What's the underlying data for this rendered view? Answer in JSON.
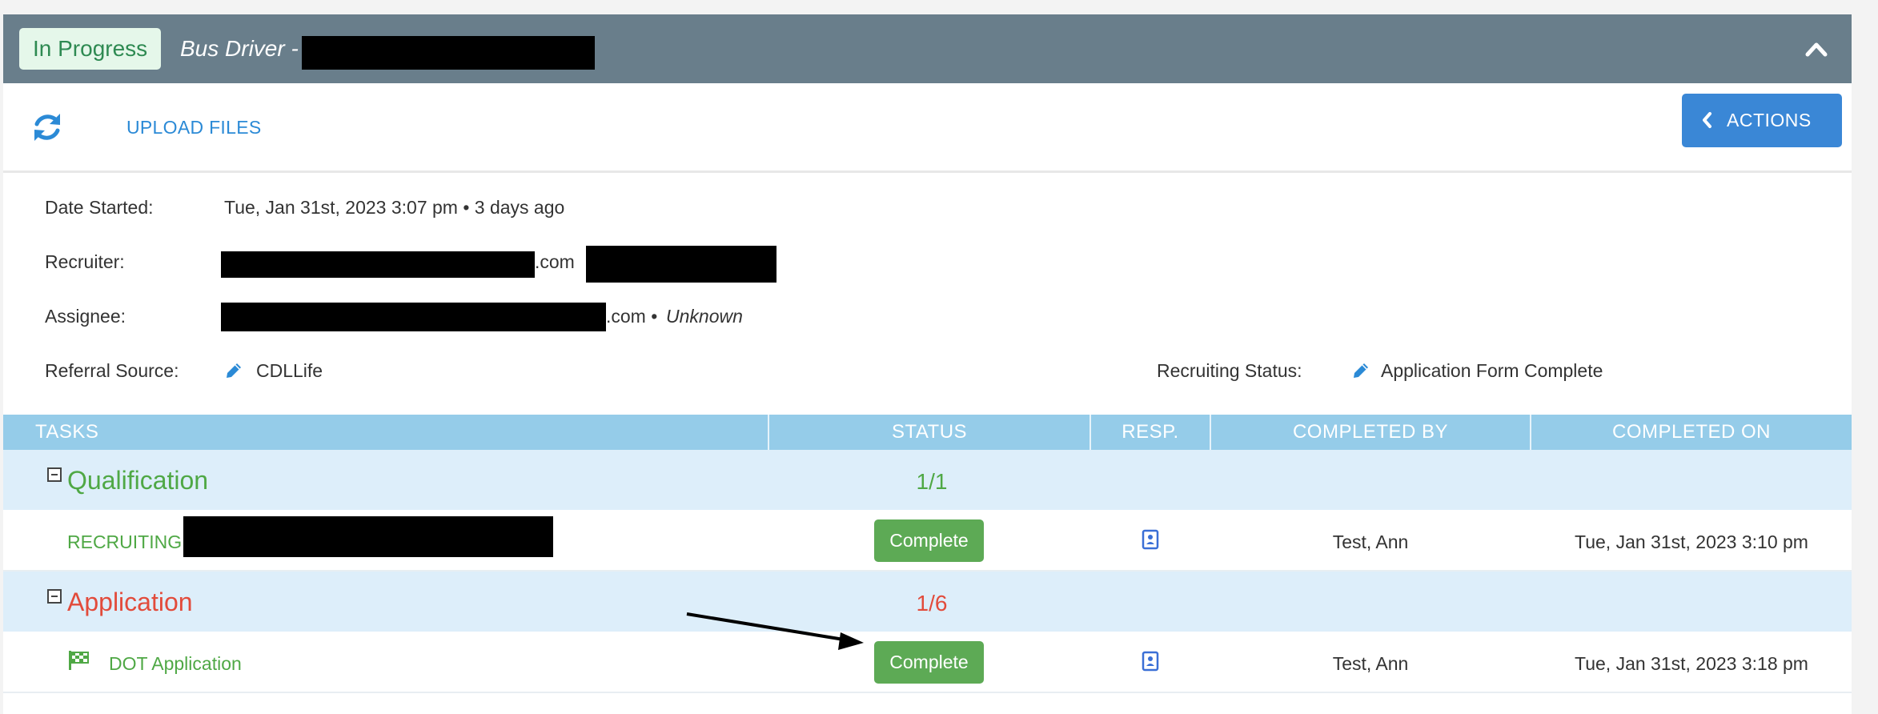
{
  "header": {
    "status_badge": "In Progress",
    "title": "Bus Driver -"
  },
  "toolbar": {
    "refresh_icon": "refresh-icon",
    "upload_label": "UPLOAD FILES",
    "actions_label": "ACTIONS"
  },
  "info": {
    "date_started_label": "Date Started:",
    "date_started_value": "Tue, Jan 31st, 2023 3:07 pm • 3 days ago",
    "recruiter_label": "Recruiter:",
    "recruiter_suffix": ".com",
    "assignee_label": "Assignee:",
    "assignee_suffix": ".com •",
    "assignee_status": "Unknown",
    "referral_label": "Referral Source:",
    "referral_value": "CDLLife",
    "recruiting_status_label": "Recruiting Status:",
    "recruiting_status_value": "Application Form Complete"
  },
  "table": {
    "headers": {
      "tasks": "TASKS",
      "status": "STATUS",
      "resp": "RESP.",
      "completed_by": "COMPLETED BY",
      "completed_on": "COMPLETED ON"
    },
    "groups": [
      {
        "name": "Qualification",
        "count": "1/1",
        "color": "#4fa845",
        "tasks": [
          {
            "name": "RECRUITING",
            "status": "Complete",
            "completed_by": "Test, Ann",
            "completed_on": "Tue, Jan 31st, 2023 3:10 pm"
          }
        ]
      },
      {
        "name": "Application",
        "count": "1/6",
        "color": "#e24b3b",
        "tasks": [
          {
            "name": "DOT Application",
            "status": "Complete",
            "completed_by": "Test, Ann",
            "completed_on": "Tue, Jan 31st, 2023 3:18 pm"
          }
        ]
      }
    ]
  },
  "colors": {
    "header_bg": "#697e8b",
    "accent_blue": "#3a87d6",
    "complete_green": "#5daa55",
    "table_header": "#95cce9",
    "group_row": "#ddeefa"
  }
}
